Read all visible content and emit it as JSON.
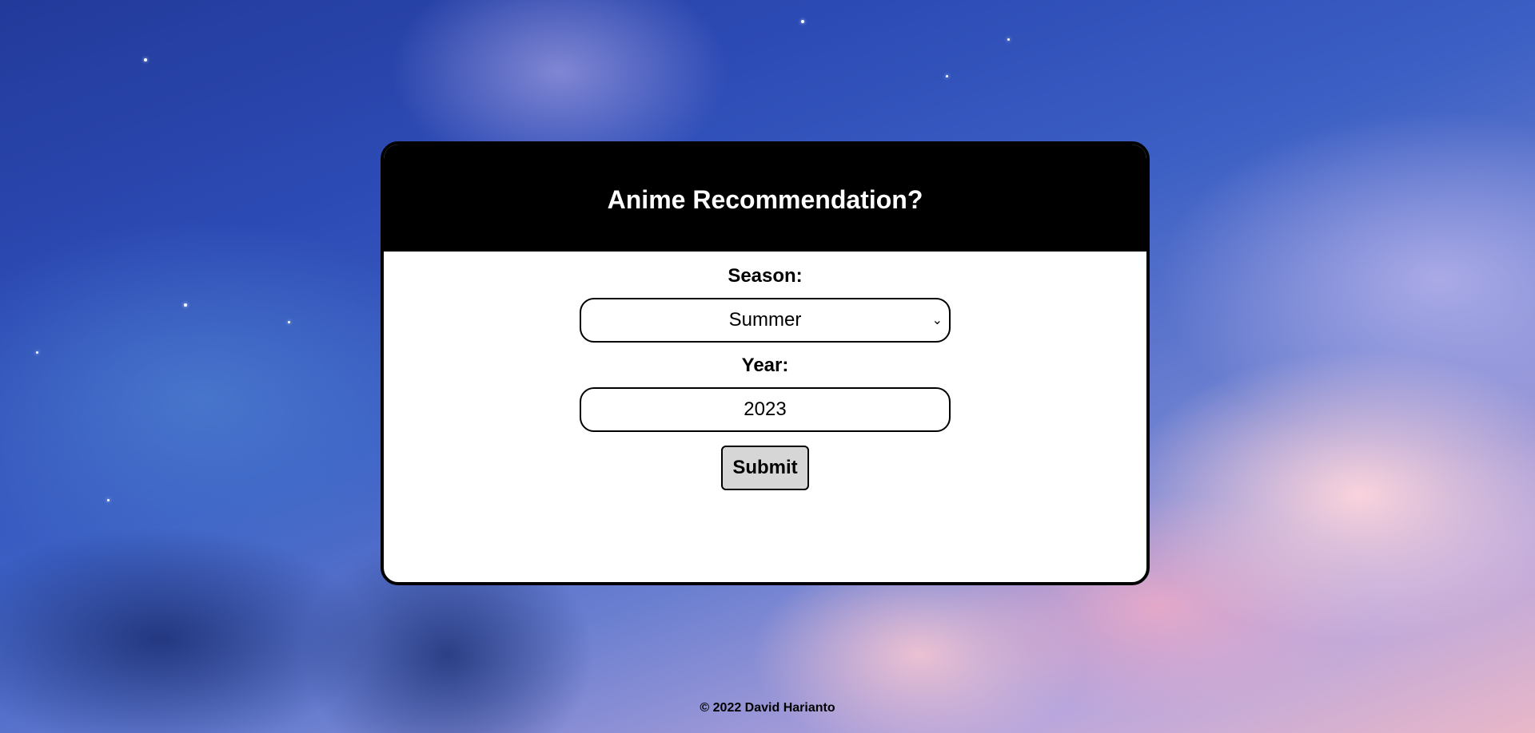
{
  "header": {
    "title": "Anime Recommendation?"
  },
  "form": {
    "season_label": "Season:",
    "season_value": "Summer",
    "year_label": "Year:",
    "year_value": "2023",
    "submit_label": "Submit"
  },
  "footer": {
    "copyright": "© 2022 David Harianto"
  },
  "colors": {
    "card_background": "#ffffff",
    "header_background": "#000000",
    "button_background": "#d6d6d6"
  }
}
